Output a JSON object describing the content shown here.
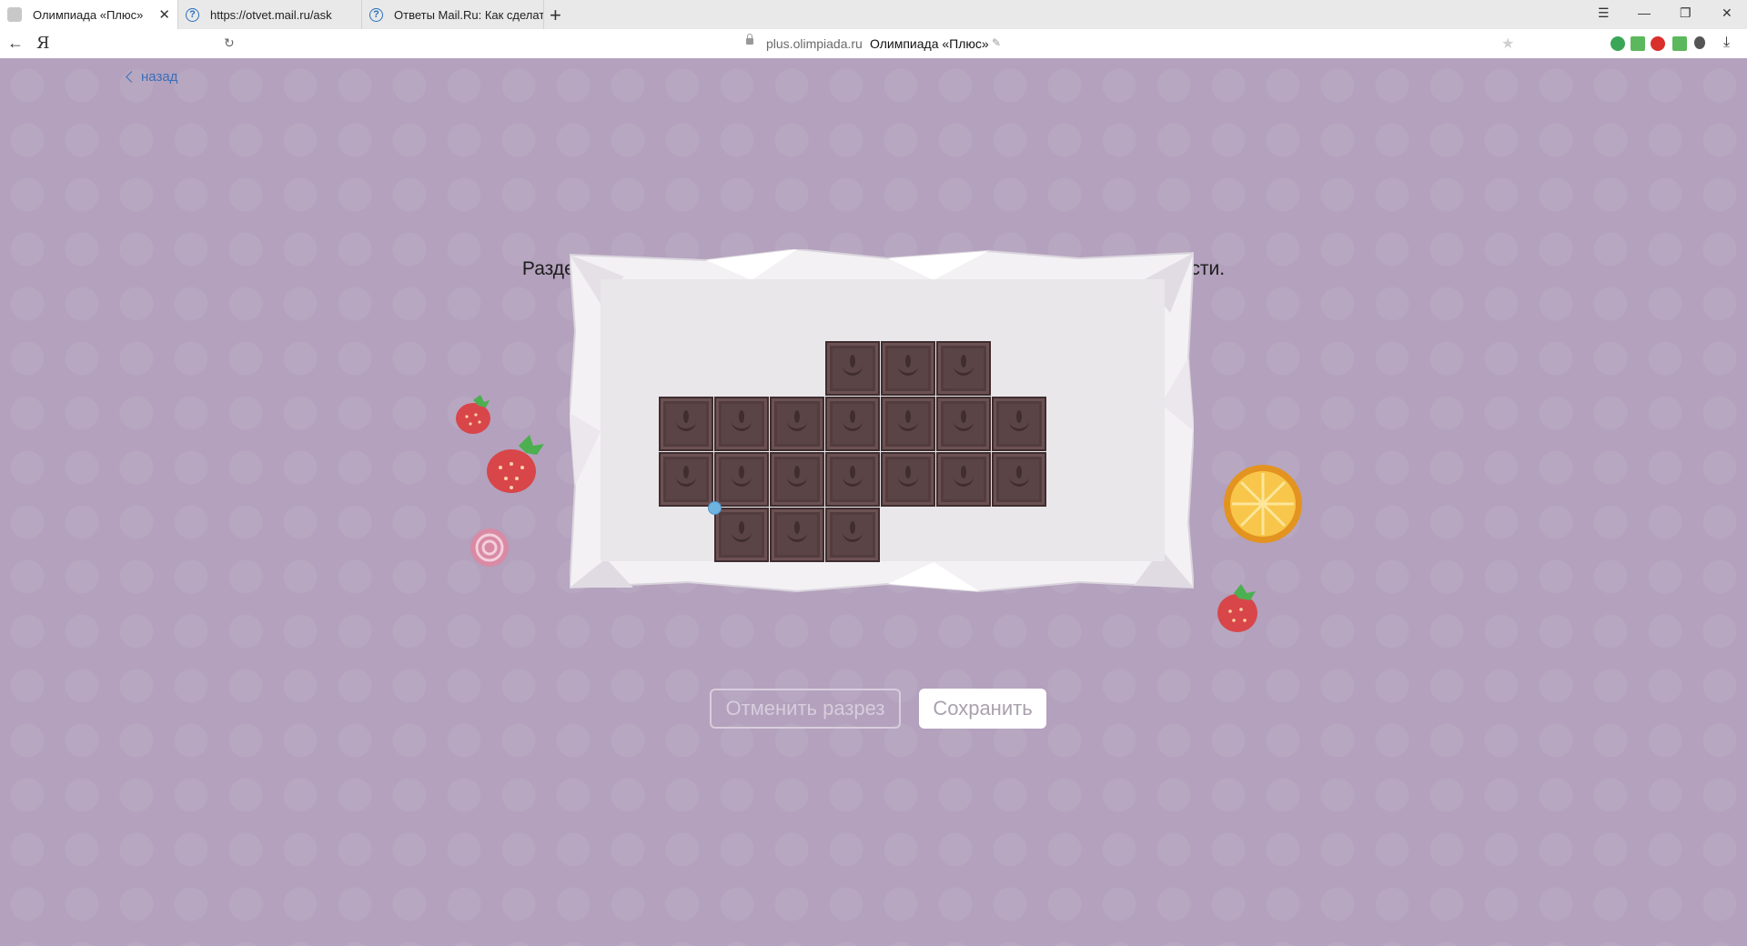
{
  "browser": {
    "tabs": [
      {
        "title": "Олимпиада «Плюс»",
        "close": "✕"
      },
      {
        "title": "https://otvet.mail.ru/ask"
      },
      {
        "title": "Ответы Mail.Ru: Как сделать"
      }
    ],
    "new_tab": "+",
    "window_controls": [
      "☰",
      "—",
      "❐",
      "✕"
    ],
    "back": "←",
    "yandex_logo": "Я",
    "reload": "↻",
    "host": "plus.olimpiada.ru",
    "page_title": "Олимпиада «Плюс»",
    "bookmark": "★",
    "download": "⤓"
  },
  "page": {
    "back_label": "назад",
    "task_text": "Раздели остаток шоколадки на четыре одинаковые по форме и размеру части.",
    "cancel_cut_label": "Отменить разрез",
    "save_label": "Сохранить"
  },
  "chocolate": {
    "rows": [
      {
        "row": 0,
        "cols": [
          3,
          4,
          5
        ]
      },
      {
        "row": 1,
        "cols": [
          0,
          1,
          2,
          3,
          4,
          5,
          6
        ]
      },
      {
        "row": 2,
        "cols": [
          0,
          1,
          2,
          3,
          4,
          5,
          6
        ]
      },
      {
        "row": 3,
        "cols": [
          1,
          2,
          3
        ]
      }
    ]
  },
  "colors": {
    "background": "#b3a1bd",
    "chocolate": "#5b4446",
    "link": "#3d6fb8",
    "cut_point": "#6fb3e0"
  }
}
